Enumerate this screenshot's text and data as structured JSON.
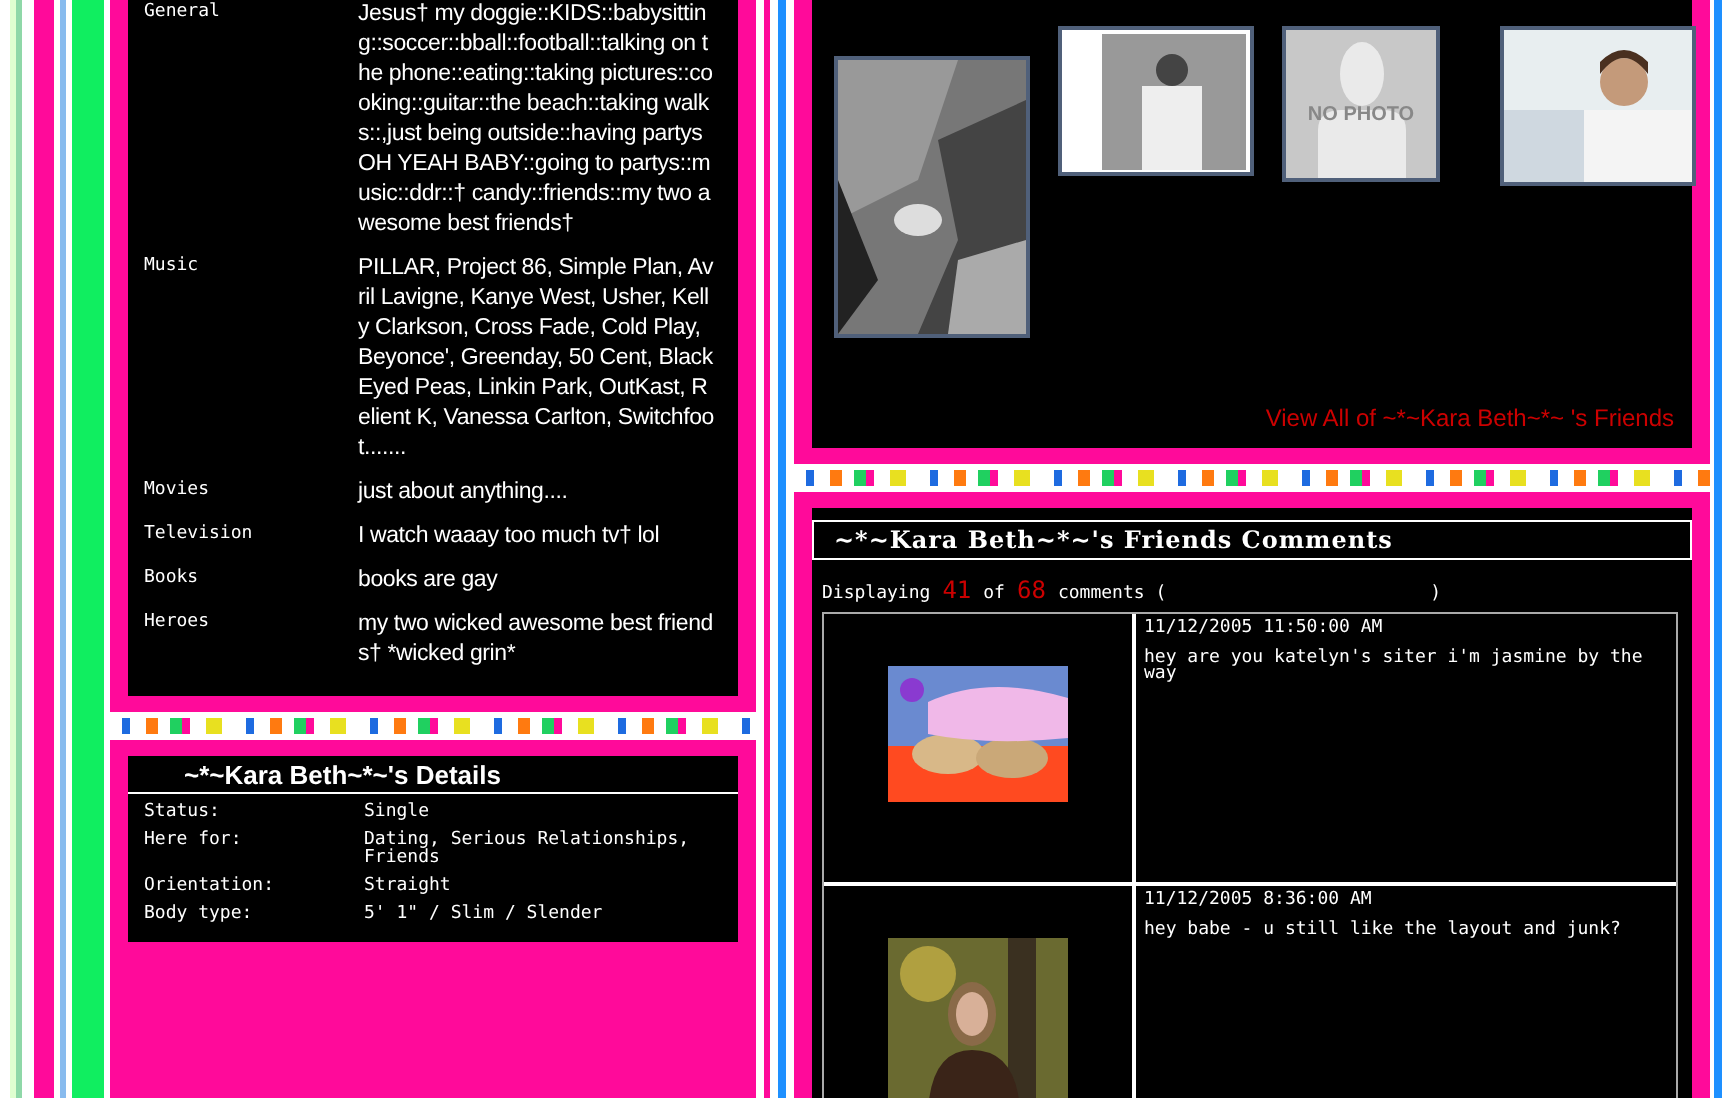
{
  "interests": [
    {
      "label": "General",
      "value": "Jesus† my doggie::KIDS::babysitting::soccer::bball::football::talking on the phone::eating::taking pictures::cooking::guitar::the beach::taking walks::,just being outside::having partys OH YEAH BABY::going to partys::music::ddr::† candy::friends::my two awesome best friends†"
    },
    {
      "label": "Music",
      "value": "PILLAR, Project 86, Simple Plan, Avril Lavigne, Kanye West, Usher, Kelly Clarkson, Cross Fade, Cold Play, Beyonce', Greenday, 50 Cent, Black Eyed Peas, Linkin Park, OutKast, Relient K, Vanessa Carlton, Switchfoot......."
    },
    {
      "label": "Movies",
      "value": "just about anything...."
    },
    {
      "label": "Television",
      "value": "I watch waaay too much tv† lol"
    },
    {
      "label": "Books",
      "value": "books are gay"
    },
    {
      "label": "Heroes",
      "value": "my two wicked awesome best friends† *wicked grin*"
    }
  ],
  "details": {
    "title": "~*~Kara Beth~*~'s Details",
    "rows": [
      {
        "label": "Status:",
        "value": "Single"
      },
      {
        "label": "Here for:",
        "value": "Dating, Serious Relationships, Friends"
      },
      {
        "label": "Orientation:",
        "value": "Straight"
      },
      {
        "label": "Body type:",
        "value": "5' 1\" / Slim / Slender"
      }
    ]
  },
  "friends": {
    "items": [
      {
        "kind": "picture"
      },
      {
        "kind": "picture"
      },
      {
        "kind": "no_photo",
        "label": "NO PHOTO"
      },
      {
        "kind": "picture"
      }
    ],
    "view_all": "View All of ~*~Kara Beth~*~ 's Friends"
  },
  "comments": {
    "title": "~*~Kara Beth~*~'s Friends Comments",
    "displaying": {
      "prefix": "Displaying",
      "shown": "41",
      "of": "of",
      "total": "68",
      "suffix": "comments (",
      "close": ")"
    },
    "rows": [
      {
        "date": "11/12/2005 11:50:00 AM",
        "text": "hey are you katelyn's siter i'm jasmine by the way"
      },
      {
        "date": "11/12/2005 8:36:00 AM",
        "text": "hey babe - u still like the layout and junk?"
      }
    ]
  }
}
